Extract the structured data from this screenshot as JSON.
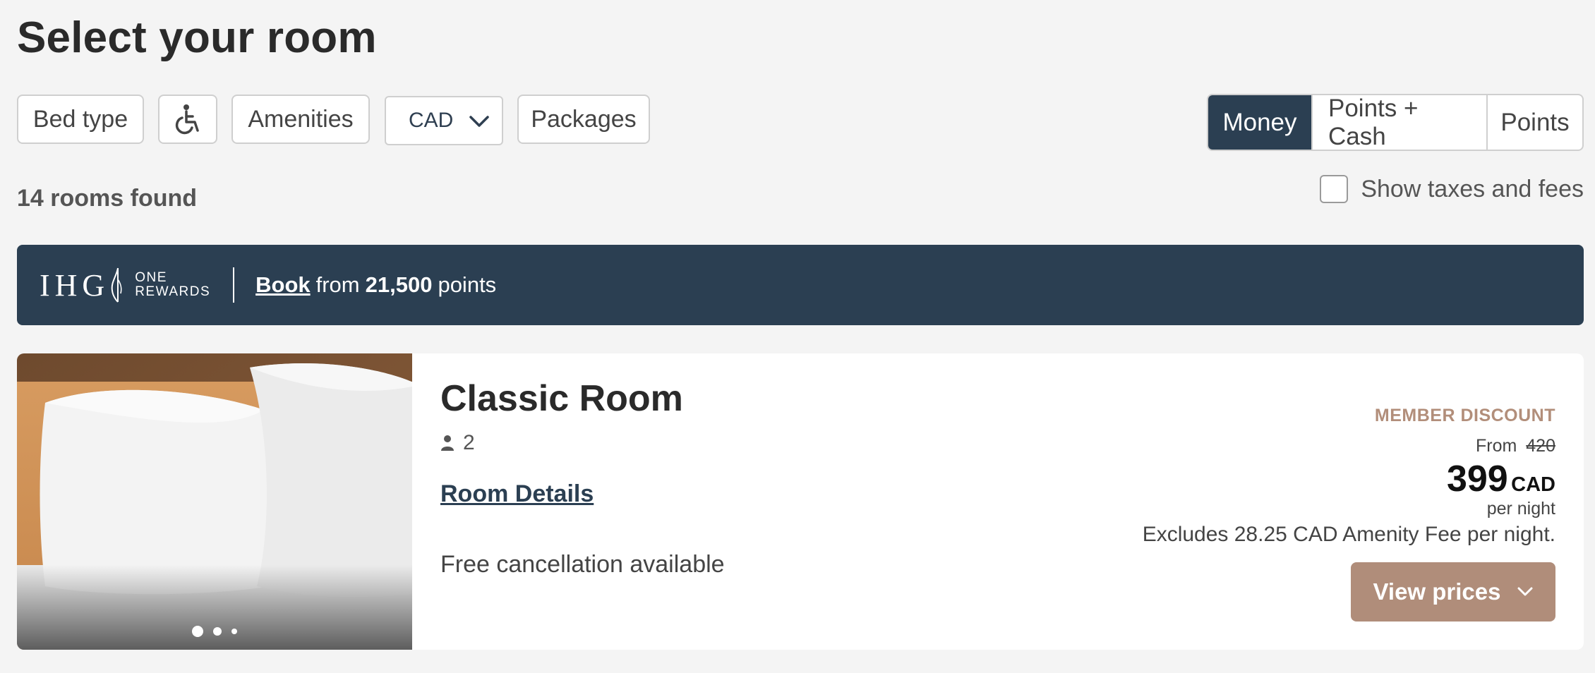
{
  "page": {
    "title": "Select your room"
  },
  "filters": {
    "bed_type": "Bed type",
    "accessibility_icon": "accessibility-icon",
    "amenities": "Amenities",
    "currency": "CAD",
    "packages": "Packages"
  },
  "payment_options": [
    {
      "label": "Money",
      "active": true
    },
    {
      "label": "Points + Cash",
      "active": false
    },
    {
      "label": "Points",
      "active": false
    }
  ],
  "results": {
    "count_text": "14 rooms found"
  },
  "taxes_toggle": {
    "label": "Show taxes and fees",
    "checked": false
  },
  "banner": {
    "logo_main": "IHG",
    "logo_sub_1": "ONE",
    "logo_sub_2": "REWARDS",
    "book_link": "Book",
    "from_text": "from",
    "points_value": "21,500",
    "points_text": "points"
  },
  "room": {
    "name": "Classic Room",
    "guests": "2",
    "details_link": "Room Details",
    "cancellation": "Free cancellation available",
    "member_label": "MEMBER DISCOUNT",
    "from_label": "From",
    "original_price": "420",
    "price": "399",
    "currency": "CAD",
    "per_night": "per night",
    "excludes": "Excludes 28.25 CAD Amenity Fee per night.",
    "view_prices": "View prices",
    "image_slides": 3,
    "active_slide": 1
  },
  "colors": {
    "navy": "#2b3f52",
    "accent": "#b08d7a",
    "member_text": "#b28e7a",
    "background": "#f4f4f4"
  }
}
